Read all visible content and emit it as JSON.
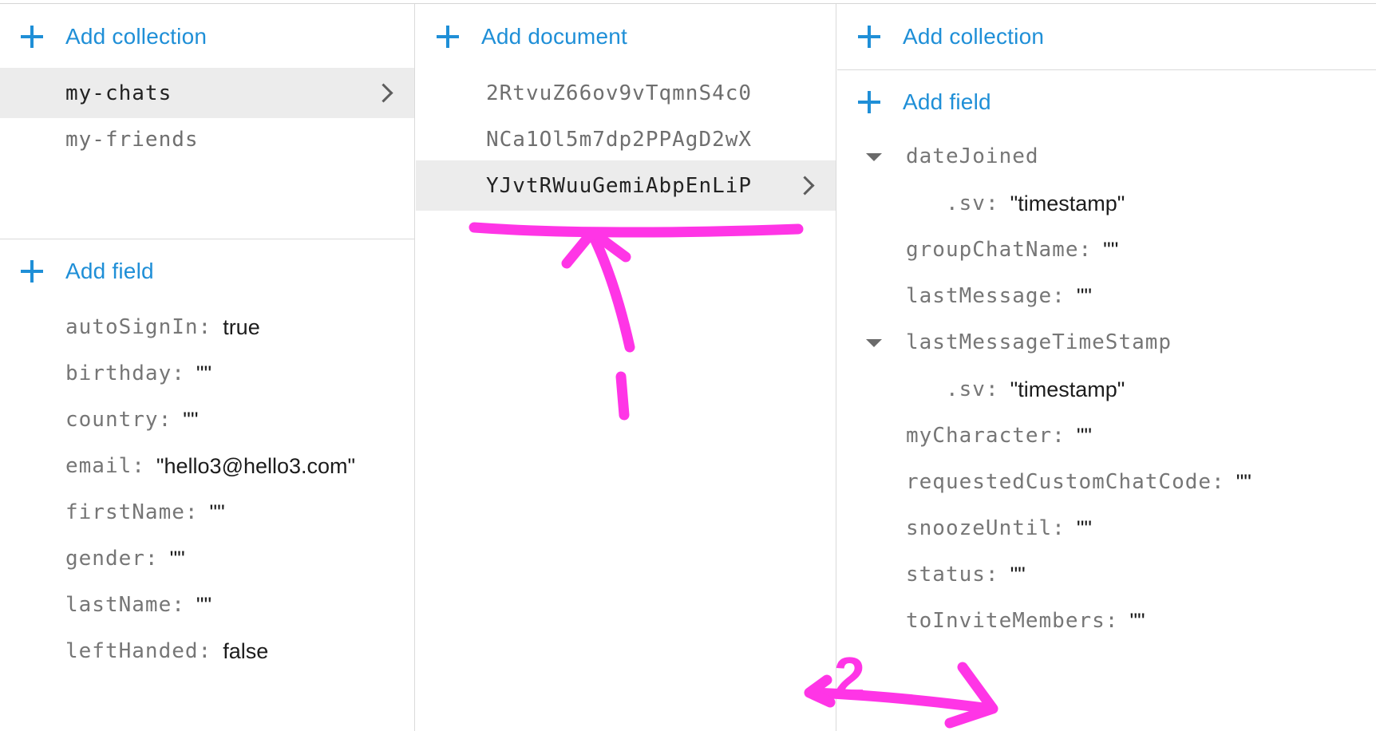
{
  "colors": {
    "accent": "#1f8fd7",
    "selected_bg": "#ececec",
    "annotation": "#ff35e6"
  },
  "columns": {
    "root": {
      "add_collection_label": "Add collection",
      "collections": [
        "my-chats",
        "my-friends"
      ],
      "selected_collection": "my-chats",
      "add_field_label": "Add field",
      "fields": [
        {
          "key": "autoSignIn:",
          "value": "true"
        },
        {
          "key": "birthday:",
          "value": "\"\""
        },
        {
          "key": "country:",
          "value": "\"\""
        },
        {
          "key": "email:",
          "value": "\"hello3@hello3.com\""
        },
        {
          "key": "firstName:",
          "value": "\"\""
        },
        {
          "key": "gender:",
          "value": "\"\""
        },
        {
          "key": "lastName:",
          "value": "\"\""
        },
        {
          "key": "leftHanded:",
          "value": "false"
        }
      ]
    },
    "collection": {
      "add_document_label": "Add document",
      "documents": [
        "2RtvuZ66ov9vTqmnS4c0",
        "NCa1Ol5m7dp2PPAgD2wX",
        "YJvtRWuuGemiAbpEnLiP"
      ],
      "selected_document": "YJvtRWuuGemiAbpEnLiP"
    },
    "document": {
      "add_collection_label": "Add collection",
      "add_field_label": "Add field",
      "fields": [
        {
          "key": "dateJoined",
          "value": "",
          "expandable": true
        },
        {
          "key": ".sv:",
          "value": "\"timestamp\"",
          "nested": true
        },
        {
          "key": "groupChatName:",
          "value": "\"\""
        },
        {
          "key": "lastMessage:",
          "value": "\"\""
        },
        {
          "key": "lastMessageTimeStamp",
          "value": "",
          "expandable": true
        },
        {
          "key": ".sv:",
          "value": "\"timestamp\"",
          "nested": true
        },
        {
          "key": "myCharacter:",
          "value": "\"\""
        },
        {
          "key": "requestedCustomChatCode:",
          "value": "\"\""
        },
        {
          "key": "snoozeUntil:",
          "value": "\"\""
        },
        {
          "key": "status:",
          "value": "\"\""
        },
        {
          "key": "toInviteMembers:",
          "value": "\"\""
        }
      ]
    }
  },
  "annotation": {
    "label": "2"
  }
}
